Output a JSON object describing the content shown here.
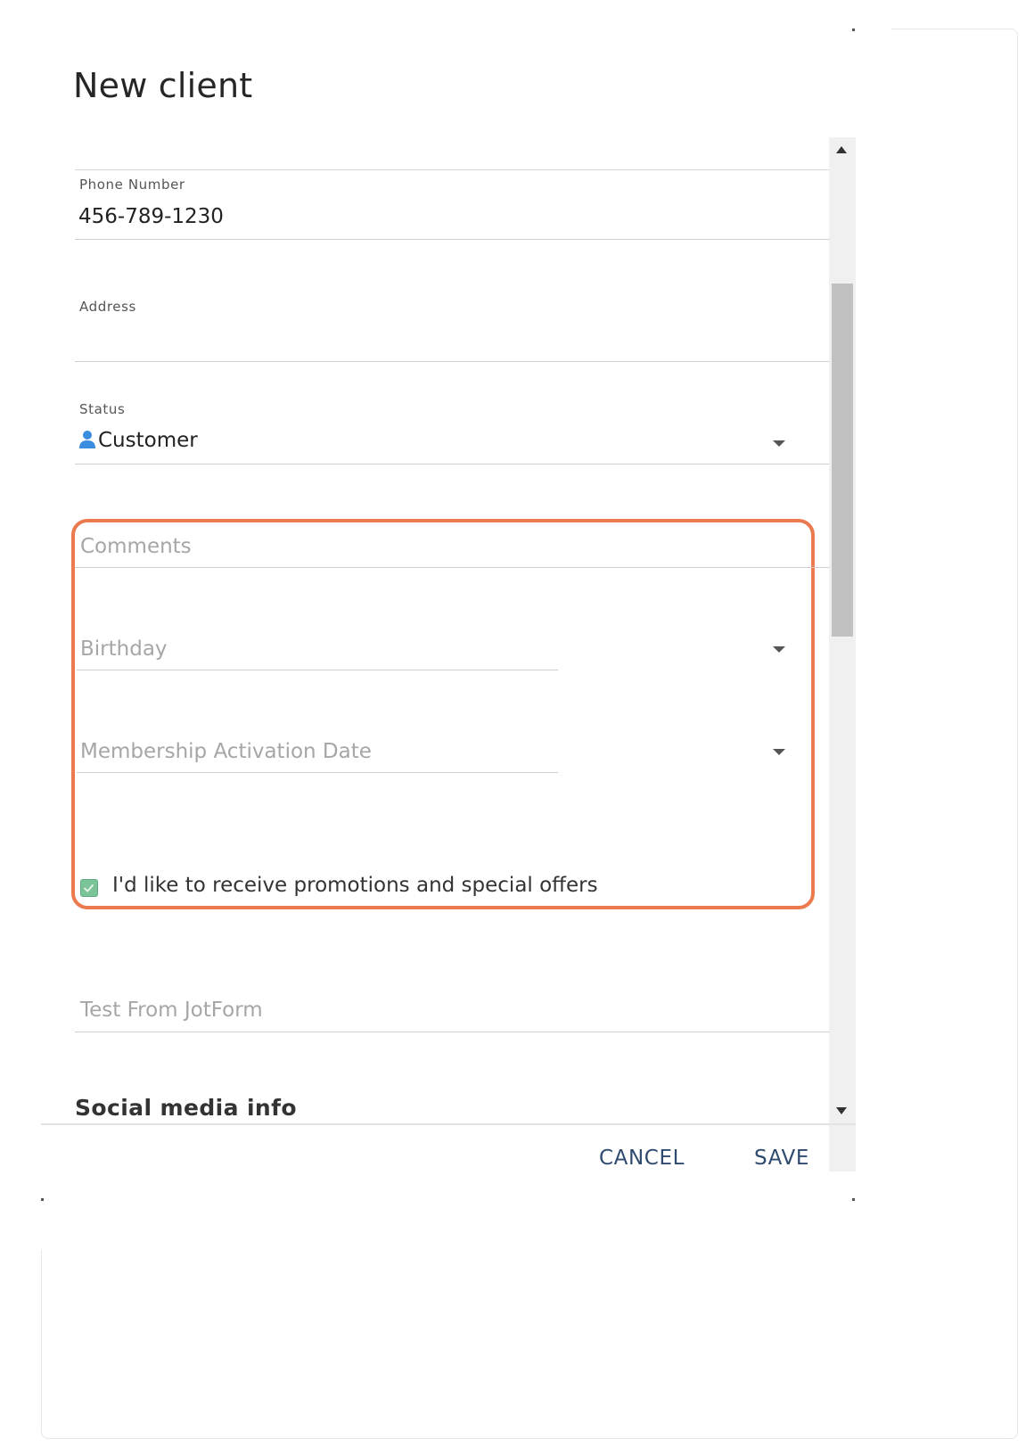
{
  "dialog": {
    "title": "New client"
  },
  "fields": {
    "phone": {
      "label": "Phone Number",
      "value": "456-789-1230"
    },
    "address": {
      "label": "Address",
      "value": ""
    },
    "status": {
      "label": "Status",
      "value": "Customer",
      "icon": "person-icon"
    },
    "comments": {
      "placeholder": "Comments"
    },
    "birthday": {
      "placeholder": "Birthday"
    },
    "membership_activation_date": {
      "placeholder": "Membership Activation Date"
    },
    "promotions": {
      "label": "I'd like to receive promotions and special offers",
      "checked": true
    },
    "test_from_jotform": {
      "placeholder": "Test From JotForm"
    }
  },
  "sections": {
    "social_media": {
      "heading": "Social media info"
    }
  },
  "footer": {
    "cancel_label": "CANCEL",
    "save_label": "SAVE"
  },
  "colors": {
    "highlight": "#ec7a4f",
    "button_text": "#2f4a6f",
    "checkbox": "#7cc39a",
    "status_icon": "#3b8de0"
  }
}
